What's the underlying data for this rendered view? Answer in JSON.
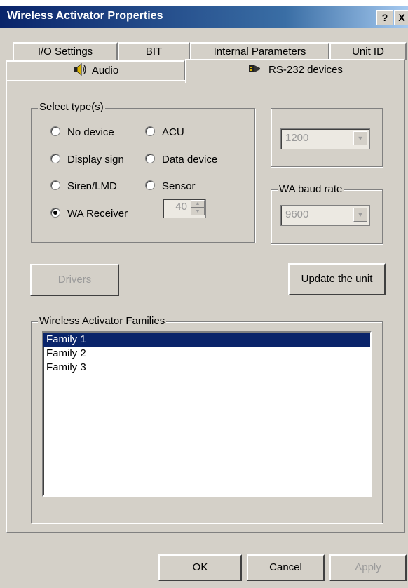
{
  "window": {
    "title": "Wireless Activator Properties",
    "help_label": "?",
    "close_label": "X"
  },
  "tabs": {
    "row1": [
      "I/O Settings",
      "BIT",
      "Internal Parameters",
      "Unit ID"
    ],
    "audio": "Audio",
    "rs232": "RS-232 devices"
  },
  "select_types": {
    "label": "Select type(s)",
    "options": {
      "no_device": "No device",
      "acu": "ACU",
      "display_sign": "Display sign",
      "data_device": "Data device",
      "siren_lmd": "Siren/LMD",
      "sensor": "Sensor",
      "wa_receiver": "WA Receiver"
    },
    "selected": "WA Receiver",
    "spin_value": "40"
  },
  "baud_top": {
    "value": "1200"
  },
  "wa_baud": {
    "label": "WA baud rate",
    "value": "9600"
  },
  "buttons": {
    "drivers": "Drivers",
    "update": "Update the unit",
    "ok": "OK",
    "cancel": "Cancel",
    "apply": "Apply"
  },
  "families": {
    "label": "Wireless Activator Families",
    "items": [
      "Family 1",
      "Family 2",
      "Family 3"
    ],
    "selected_index": 0
  }
}
